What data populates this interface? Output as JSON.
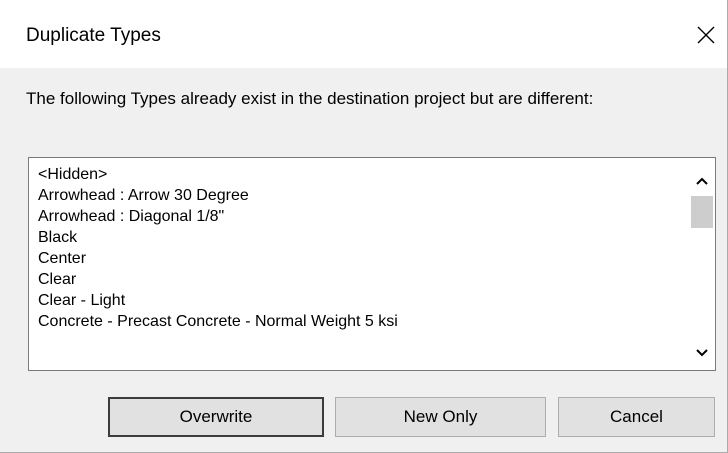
{
  "dialog": {
    "title": "Duplicate Types",
    "message": "The following Types already exist in the destination project but are different:"
  },
  "list": {
    "items": [
      "<Hidden>",
      "Arrowhead : Arrow 30 Degree",
      "Arrowhead : Diagonal 1/8\"",
      "Black",
      "Center",
      "Clear",
      "Clear - Light",
      "Concrete - Precast Concrete - Normal Weight 5 ksi"
    ]
  },
  "buttons": {
    "overwrite": "Overwrite",
    "new_only": "New Only",
    "cancel": "Cancel"
  },
  "icons": {
    "close": "close-icon",
    "scroll_up": "chevron-up-icon",
    "scroll_down": "chevron-down-icon"
  }
}
